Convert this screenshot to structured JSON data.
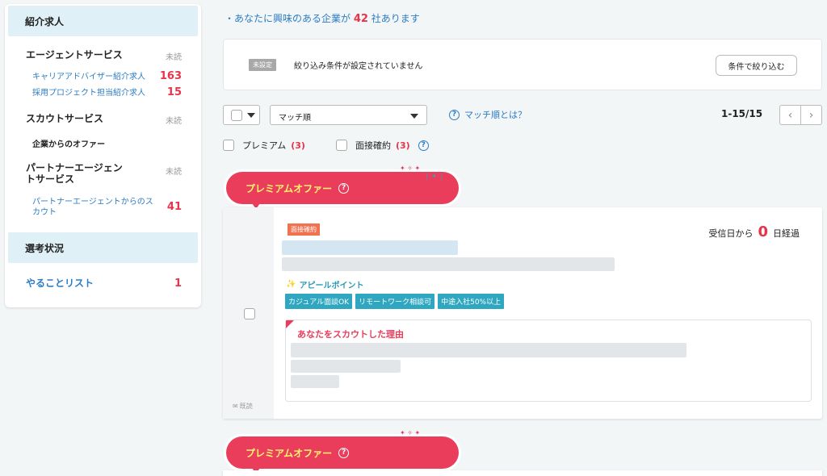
{
  "sidebar": {
    "header1": "紹介求人",
    "agent_service": "エージェントサービス",
    "unread": "未読",
    "career_advisor": "キャリアアドバイザー紹介求人",
    "career_advisor_count": "163",
    "recruit_project": "採用プロジェクト担当紹介求人",
    "recruit_project_count": "15",
    "scout_service": "スカウトサービス",
    "company_offer": "企業からのオファー",
    "partner_service": "パートナーエージェントサービス",
    "partner_scout": "パートナーエージェントからのスカウト",
    "partner_scout_count": "41",
    "header2": "選考状況",
    "todo": "やることリスト",
    "todo_count": "1"
  },
  "main": {
    "count_prefix": "・あなたに興味のある企業が",
    "count_num": "42",
    "count_suffix": "社あります",
    "filter_tag": "未設定",
    "filter_text": "絞り込み条件が設定されていません",
    "filter_button": "条件で絞り込む",
    "sort_value": "マッチ順",
    "match_help": "マッチ順とは？",
    "pager": "1-15/15",
    "premium_label": "プレミアム",
    "premium_count": "(3)",
    "interview_label": "面接確約",
    "interview_count": "(3)"
  },
  "cards": [
    {
      "ribbon": "プレミアムオファー",
      "badge": "面接確約",
      "received_prefix": "受信日から",
      "received_days": "0",
      "received_suffix": "日経過",
      "appeal": "アピールポイント",
      "tags": [
        "カジュアル面談OK",
        "リモートワーク相談可",
        "中途入社50%以上"
      ],
      "scout_title": "あなたをスカウトした理由",
      "read_status": "既読"
    }
  ],
  "ribbon2": "プレミアムオファー"
}
